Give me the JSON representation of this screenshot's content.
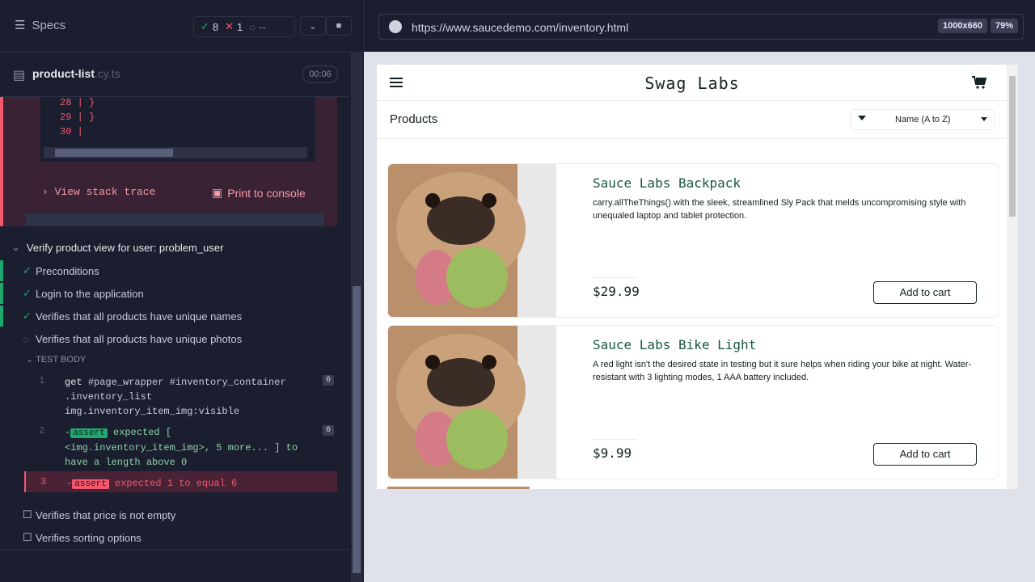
{
  "left": {
    "specs_label": "Specs",
    "stats": {
      "passed": "8",
      "failed": "1",
      "pending": "--"
    },
    "file": {
      "name": "product-list",
      "ext": ".cy.ts",
      "timer": "00:06"
    },
    "code_lines": [
      {
        "num": "28",
        "code": "  }"
      },
      {
        "num": "29",
        "code": "}"
      },
      {
        "num": "30",
        "code": ""
      }
    ],
    "view_stack": "View stack trace",
    "print_console": "Print to console",
    "test_title": "Verify product view for user: problem_user",
    "steps": [
      {
        "label": "Preconditions",
        "state": "passed"
      },
      {
        "label": "Login to the application",
        "state": "passed"
      },
      {
        "label": "Verifies that all products have unique names",
        "state": "passed"
      },
      {
        "label": "Verifies that all products have unique photos",
        "state": "running"
      }
    ],
    "test_body_label": "TEST BODY",
    "commands": [
      {
        "num": "1",
        "cmd": "get",
        "text": "#page_wrapper #inventory_container .inventory_list img.inventory_item_img:visible",
        "badge": "6"
      },
      {
        "num": "2",
        "prefix": "-",
        "cmd": "assert",
        "text": "expected [ <img.inventory_item_img>, 5 more... ] to have a length above 0",
        "badge": "6"
      },
      {
        "num": "3",
        "prefix": "-",
        "cmd": "assert",
        "text": "expected 1 to equal 6",
        "badge": ""
      }
    ],
    "pending_steps": [
      {
        "label": "Verifies that price is not empty"
      },
      {
        "label": "Verifies sorting options"
      }
    ]
  },
  "browser": {
    "url": "https://www.saucedemo.com/inventory.html",
    "viewport": "1000x660",
    "zoom": "79%"
  },
  "app": {
    "brand": "Swag Labs",
    "section_title": "Products",
    "sort_value": "Name (A to Z)",
    "products": [
      {
        "name": "Sauce Labs Backpack",
        "description": "carry.allTheThings() with the sleek, streamlined Sly Pack that melds uncompromising style with unequaled laptop and tablet protection.",
        "price": "$29.99",
        "button": "Add to cart"
      },
      {
        "name": "Sauce Labs Bike Light",
        "description": "A red light isn't the desired state in testing but it sure helps when riding your bike at night. Water-resistant with 3 lighting modes, 1 AAA battery included.",
        "price": "$9.99",
        "button": "Add to cart"
      }
    ]
  }
}
